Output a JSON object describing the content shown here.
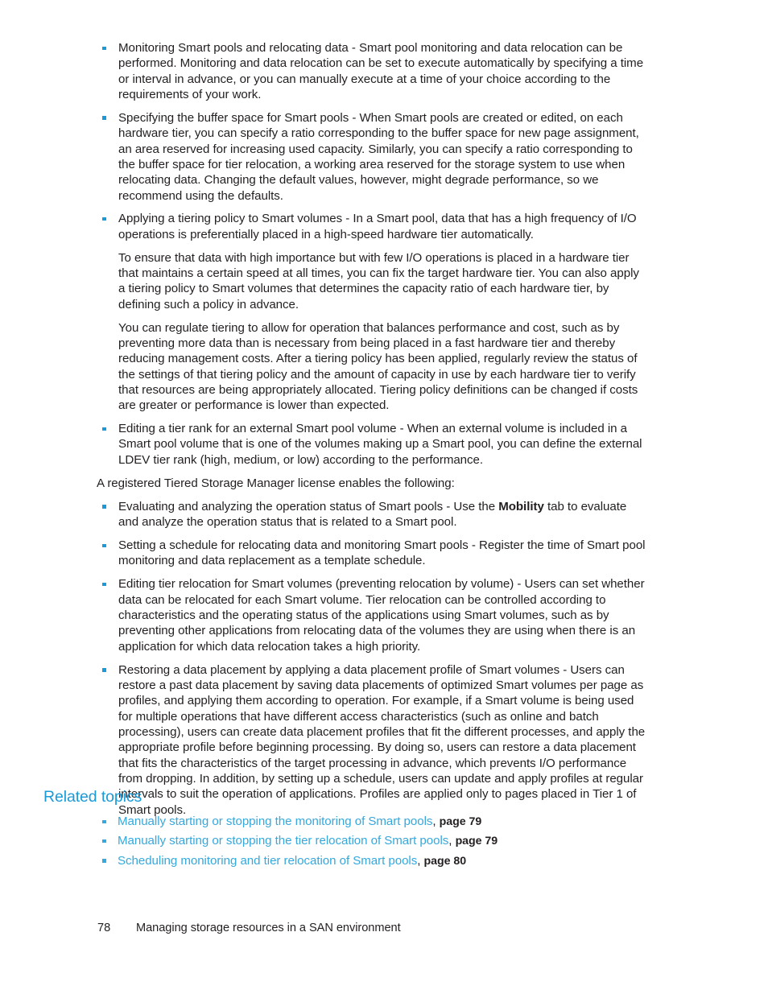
{
  "document": {
    "body_bullets": [
      {
        "text": "Monitoring Smart pools and relocating data - Smart pool monitoring and data relocation can be performed. Monitoring and data relocation can be set to execute automatically by specifying a time or interval in advance, or you can manually execute at a time of your choice according to the requirements of your work."
      },
      {
        "text": "Specifying the buffer space for Smart pools - When Smart pools are created or edited, on each hardware tier, you can specify a ratio corresponding to the buffer space for new page assignment, an area reserved for increasing used capacity. Similarly, you can specify a ratio corresponding to the buffer space for tier relocation, a working area reserved for the storage system to use when relocating data. Changing the default values, however, might degrade performance, so we recommend using the defaults."
      },
      {
        "text": "Applying a tiering policy to Smart volumes - In a Smart pool, data that has a high frequency of I/O operations is preferentially placed in a high-speed hardware tier automatically.",
        "sub_paragraph_1": "To ensure that data with high importance but with few I/O operations is placed in a hardware tier that maintains a certain speed at all times, you can fix the target hardware tier. You can also apply a tiering policy to Smart volumes that determines the capacity ratio of each hardware tier, by defining such a policy in advance.",
        "sub_paragraph_2": "You can regulate tiering to allow for operation that balances performance and cost, such as by preventing more data than is necessary from being placed in a fast hardware tier and thereby reducing management costs. After a tiering policy has been applied, regularly review the status of the settings of that tiering policy and the amount of capacity in use by each hardware tier to verify that resources are being appropriately allocated. Tiering policy definitions can be changed if costs are greater or performance is lower than expected."
      },
      {
        "text": "Editing a tier rank for an external Smart pool volume - When an external volume is included in a Smart pool volume that is one of the volumes making up a Smart pool, you can define the external LDEV tier rank (high, medium, or low) according to the performance."
      }
    ],
    "license_intro": "A registered Tiered Storage Manager license enables the following:",
    "license_bullets": [
      {
        "before": "Evaluating and analyzing the operation status of Smart pools - Use the ",
        "bold": "Mobility",
        "after": " tab to evaluate and analyze the operation status that is related to a Smart pool."
      },
      {
        "before": "Setting a schedule for relocating data and monitoring Smart pools - Register the time of Smart pool monitoring and data replacement as a template schedule.",
        "bold": "",
        "after": ""
      },
      {
        "before": "Editing tier relocation for Smart volumes (preventing relocation by volume) - Users can set whether data can be relocated for each Smart volume. Tier relocation can be controlled according to characteristics and the operating status of the applications using Smart volumes, such as by preventing other applications from relocating data of the volumes they are using when there is an application for which data relocation takes a high priority.",
        "bold": "",
        "after": ""
      },
      {
        "before": "Restoring a data placement by applying a data placement profile of Smart volumes - Users can restore a past data placement by saving data placements of optimized Smart volumes per page as profiles, and applying them according to operation. For example, if a Smart volume is being used for multiple operations that have different access characteristics (such as online and batch processing), users can create data placement profiles that fit the different processes, and apply the appropriate profile before beginning processing. By doing so, users can restore a data placement that fits the characteristics of the target processing in advance, which prevents I/O performance from dropping. In addition, by setting up a schedule, users can update and apply profiles at regular intervals to suit the operation of applications. Profiles are applied only to pages placed in Tier 1 of Smart pools.",
        "bold": "",
        "after": ""
      }
    ]
  },
  "related_topics": {
    "heading": "Related topics",
    "items": [
      {
        "link": "Manually starting or stopping the monitoring of Smart pools",
        "separator": ", ",
        "page": "page 79"
      },
      {
        "link": "Manually starting or stopping the tier relocation of Smart pools",
        "separator": ", ",
        "page": "page 79"
      },
      {
        "link": "Scheduling monitoring and tier relocation of Smart pools",
        "separator": ", ",
        "page": "page 80"
      }
    ]
  },
  "footer": {
    "page_number": "78",
    "chapter_title": "Managing storage resources in a SAN environment"
  },
  "colors": {
    "accent_blue": "#1b9ad7",
    "link_blue": "#35a8dd",
    "body_text": "#231f20",
    "page_background": "#ffffff"
  }
}
